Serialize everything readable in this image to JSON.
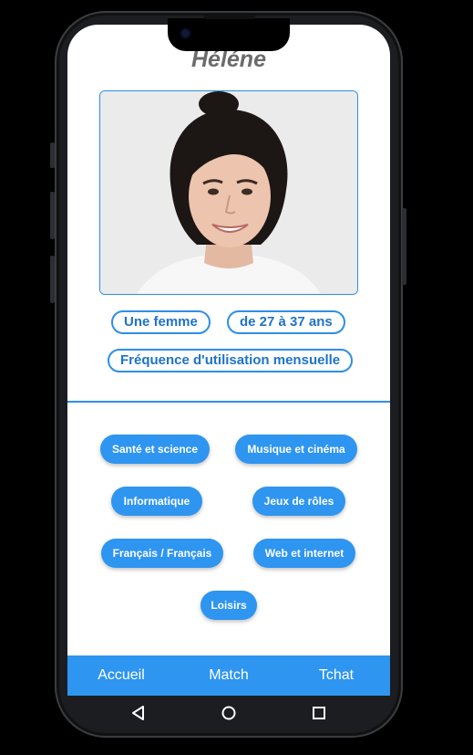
{
  "profile": {
    "name": "Héléne",
    "tags": {
      "gender": "Une femme",
      "age_range": "de 27 à 37 ans",
      "frequency": "Fréquence d'utilisation mensuelle"
    }
  },
  "interests": [
    "Santé et science",
    "Musique et cinéma",
    "Informatique",
    "Jeux de rôles",
    "Français / Français",
    "Web et internet",
    "Loisirs"
  ],
  "bottom_nav": {
    "items": [
      "Accueil",
      "Match",
      "Tchat"
    ]
  },
  "colors": {
    "accent": "#2e95f0",
    "accent_dark": "#1e73c8",
    "title_gray": "#6b6b6b"
  },
  "icons": {
    "back": "back-triangle-icon",
    "home": "home-circle-icon",
    "recents": "recents-square-icon"
  }
}
